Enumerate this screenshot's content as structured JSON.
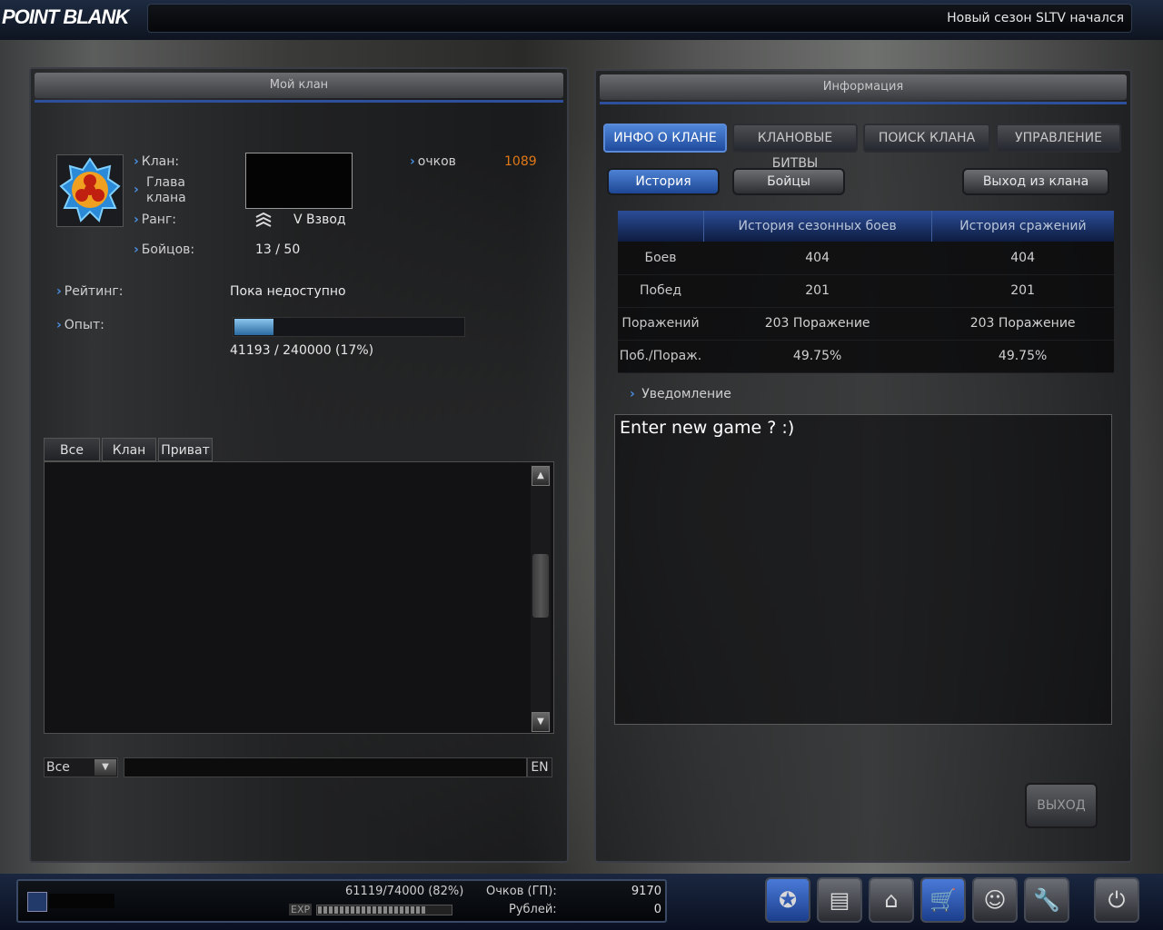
{
  "header": {
    "logo": "POINT BLANK",
    "news": "Новый сезон SLTV начался"
  },
  "left_panel": {
    "title": "Мой клан",
    "clan_label": "Клан:",
    "leader_label": "Глава\nклана",
    "rank_label": "Ранг:",
    "fighters_label": "Бойцов:",
    "points_label": "очков",
    "points_value": "1089",
    "rank_value": "V Взвод",
    "fighters_value": "13 / 50",
    "rating_label": "Рейтинг:",
    "rating_value": "Пока недоступно",
    "exp_label": "Опыт:",
    "exp_text": "41193 / 240000 (17%)",
    "exp_fraction": 0.17
  },
  "chat": {
    "tabs": [
      "Все",
      "Клан",
      "Приват"
    ],
    "channel": "Все",
    "lang": "EN"
  },
  "right_panel": {
    "title": "Информация",
    "tabs": [
      "ИНФО О КЛАНЕ",
      "КЛАНОВЫЕ БИТВЫ",
      "ПОИСК КЛАНА",
      "УПРАВЛЕНИЕ"
    ],
    "subtabs": [
      "История",
      "Бойцы"
    ],
    "leave_button": "Выход из клана",
    "table": {
      "headers": [
        "История сезонных боев",
        "История сражений"
      ],
      "rows": [
        {
          "label": "Боев",
          "season": "404",
          "battles": "404"
        },
        {
          "label": "Побед",
          "season": "201",
          "battles": "201"
        },
        {
          "label": "Поражений",
          "season": "203 Поражение",
          "battles": "203 Поражение"
        },
        {
          "label": "Поб./Пораж.",
          "season": "49.75%",
          "battles": "49.75%"
        }
      ]
    },
    "notice_label": "Уведомление",
    "notice_text": "Enter new game ? :)",
    "exit_button": "ВЫХОД"
  },
  "player_bar": {
    "exp_text": "61119/74000 (82%)",
    "exp_fraction": 0.82,
    "exp_label": "EXP",
    "points_label": "Очков (ГП):",
    "points_value": "9170",
    "rubles_label": "Рублей:",
    "rubles_value": "0"
  },
  "bottom_icons": [
    "clan-icon",
    "profile-icon",
    "inventory-icon",
    "shop-icon",
    "community-icon",
    "settings-icon",
    "power-icon"
  ]
}
